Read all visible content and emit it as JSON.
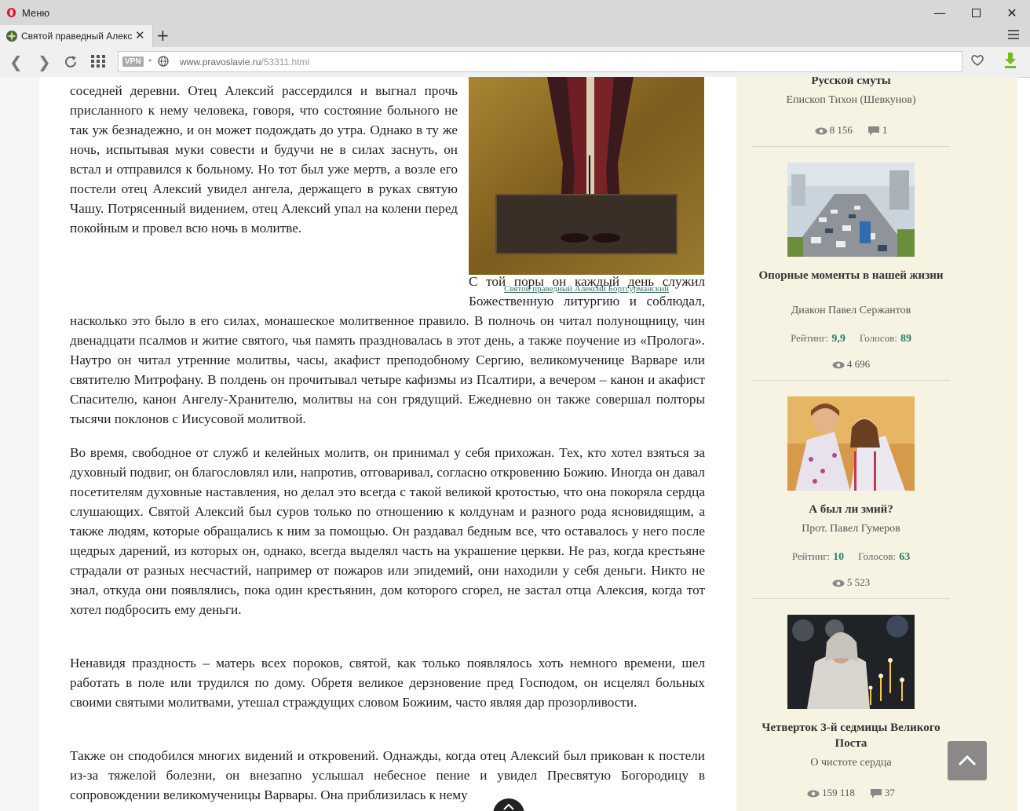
{
  "browser": {
    "menu_label": "Меню",
    "tab_title": "Святой праведный Алексий Бортсурманский",
    "vpn_label": "VPN",
    "url_domain": "www.pravoslavie.ru",
    "url_path": "/53311.html"
  },
  "article": {
    "paragraphs": [
      "соседней деревни. Отец Алексий рассердился и выгнал прочь присланного к нему человека, говоря, что состояние больного не так уж безнадежно, и он может подождать до утра. Однако в ту же ночь, испытывая муки совести и будучи не в силах заснуть, он встал и отправился к больному. Но тот был уже мертв, а возле его постели отец Алексий увидел ангела, держащего в руках святую Чашу. Потрясенный видением, отец Алексий упал на колени перед покойным и провел всю ночь в молитве.",
      "С той поры он каждый день служил Божественную литургию и соблюдал, насколько это было в его силах, монашеское молитвенное правило. В полночь он читал полунощницу, чин двенадцати псалмов и житие святого, чья память праздновалась в этот день, а также поучение из «Пролога». Наутро он читал утренние молитвы, часы, акафист преподобному Сергию, великомученице Варваре или святителю Митрофану. В полдень он прочитывал четыре кафизмы из Псалтири, а вечером – канон и акафист Спасителю, канон Ангелу-Хранителю, молитвы на сон грядущий. Ежедневно он также совершал полторы тысячи поклонов с Иисусовой молитвой.",
      "Во время, свободное от служб и келейных молитв, он принимал у себя прихожан. Тех, кто хотел взяться за духовный подвиг, он благословлял или, напротив, отговаривал, согласно откровению Божию. Иногда он давал посетителям духовные наставления, но делал это всегда с такой великой кротостью, что она покоряла сердца слушающих. Святой Алексий был суров только по отношению к колдунам и разного рода ясновидящим, а также людям, которые обращались к ним за помощью. Он раздавал бедным все, что оставалось у него после щедрых дарений, из которых он, однако, всегда выделял часть на украшение церкви. Не раз, когда крестьяне страдали от разных несчастий, например от пожаров или эпидемий, они находили у себя деньги. Никто не знал, откуда они появлялись, пока один крестьянин, дом которого сгорел, не застал отца Алексия, когда тот хотел подбросить ему деньги.",
      "Ненавидя праздность – матерь всех пороков, святой, как только появлялось хоть немного времени, шел работать в поле или трудился по дому. Обретя великое дерзновение пред Господом, он исцелял больных своими святыми молитвами, утешал страждущих словом Божиим, часто являя дар прозорливости.",
      "Также он сподобился многих видений и откровений. Однажды, когда отец Алексий был прикован к постели из-за тяжелой болезни, он внезапно услышал небесное пение и увидел Пресвятую Богородицу в сопровождении великомученицы Варвары. Она приблизилась к нему"
    ],
    "image_caption": "Святой праведный Алексий Бортсурманский"
  },
  "sidebar": {
    "items": [
      {
        "title": "Русской смуты",
        "author": "Епископ Тихон (Шевкунов)",
        "views": "8 156",
        "comments": "1"
      },
      {
        "title": "Опорные моменты в нашей жизни",
        "author": "Диакон Павел Сержантов",
        "rating_label": "Рейтинг:",
        "rating": "9,9",
        "votes_label": "Голосов:",
        "votes": "89",
        "views": "4 696"
      },
      {
        "title": "А был ли змий?",
        "author": "Прот. Павел Гумеров",
        "rating_label": "Рейтинг:",
        "rating": "10",
        "votes_label": "Голосов:",
        "votes": "63",
        "views": "5 523"
      },
      {
        "title": "Четверток 3-й седмицы Великого Поста",
        "author": "О чистоте сердца",
        "views": "159 118",
        "comments": "37"
      }
    ]
  },
  "icons": [
    "opera-logo-icon",
    "minimize-icon",
    "maximize-icon",
    "close-icon",
    "favicon-icon",
    "tab-close-icon",
    "new-tab-icon",
    "tab-menu-icon",
    "back-icon",
    "forward-icon",
    "reload-icon",
    "speed-dial-icon",
    "globe-icon",
    "heart-icon",
    "download-icon",
    "eye-icon",
    "comment-icon",
    "arrow-up-icon"
  ],
  "colors": {
    "accent_green": "#2d7d6a",
    "sidebar_bg": "#f7f3e3",
    "browser_chrome": "#d8d8d8"
  }
}
